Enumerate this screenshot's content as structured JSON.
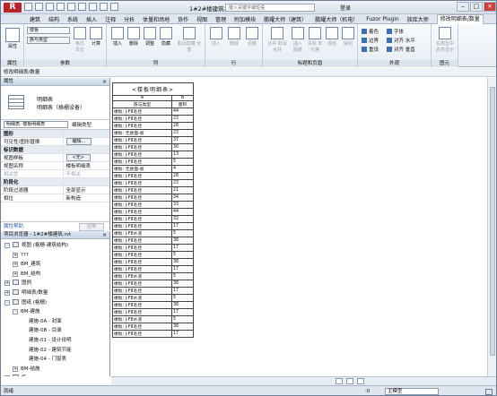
{
  "window": {
    "title": "1#2#楼建筑.rvt -",
    "search_placeholder": "键入关键字或短语",
    "login": "登录"
  },
  "tabs": [
    "建筑",
    "结构",
    "系统",
    "插入",
    "注释",
    "分析",
    "体量和场地",
    "协作",
    "视图",
    "管理",
    "附加模块",
    "鹏耀大师（建筑）",
    "鹏耀大师（机电）",
    "Fuzor Plugin",
    "族库大师",
    "修改明细表/数量"
  ],
  "ribbon": {
    "properties": {
      "label": "属性",
      "group": "属性"
    },
    "params": {
      "combo1": "楼板",
      "combo2": "族与类型",
      "format_unit": "格式\n单位",
      "calculate": "计算",
      "group": "参数"
    },
    "cols": {
      "insert": "插入",
      "delete": "删除",
      "resize": "调整",
      "hide": "隐藏",
      "unhide_all": "取消隐藏\n全部",
      "group": "列"
    },
    "rows": {
      "insert": "插入",
      "delete": "删除",
      "resize": "调整",
      "group": "行"
    },
    "titles": {
      "merge": "合并\n取消合并",
      "insert_image": "插入\n图像",
      "clear_cell": "清除\n单元格",
      "group_btn": "成组",
      "ungroup": "解组",
      "group": "标题和页眉"
    },
    "appearance": {
      "shading": "着色",
      "borders": "边界",
      "reset": "重设",
      "font": "字体",
      "align_h": "对齐\n水平",
      "align_v": "对齐\n垂直",
      "group": "外观"
    },
    "element": {
      "highlight": "在模型中\n高亮显示",
      "group": "图元"
    }
  },
  "modify_bar": "修改明细表/数量",
  "properties": {
    "header": "属性",
    "type_name": "明细表",
    "type_sub": "明细表（格栅设备）",
    "selector": "明细表: 楼板明细表",
    "edit_type": "编辑类型",
    "rows": [
      {
        "section": true,
        "name": "图形",
        "value": ""
      },
      {
        "name": "可见性/图形替换",
        "value": "编辑...",
        "button": true
      },
      {
        "section": true,
        "name": "标识数据",
        "value": ""
      },
      {
        "name": "视图样板",
        "value": "<无>",
        "button": true
      },
      {
        "name": "视图名称",
        "value": "楼板明细表"
      },
      {
        "name": "相关性",
        "value": "不相关",
        "grey": true
      },
      {
        "section": true,
        "name": "阶段化",
        "value": ""
      },
      {
        "name": "阶段过滤器",
        "value": "全部显示"
      },
      {
        "name": "相位",
        "value": "新构造"
      }
    ],
    "help": "属性帮助",
    "apply": "应用"
  },
  "browser": {
    "header": "项目浏览器 - 1#2#楼建筑.rvt",
    "items": [
      {
        "label": "视图 (格栅-建筑结构)",
        "indent": 0,
        "toggle": "-",
        "icon": true
      },
      {
        "label": "???",
        "indent": 1,
        "toggle": "+"
      },
      {
        "label": "BM_建筑",
        "indent": 1,
        "toggle": "+"
      },
      {
        "label": "BM_结构",
        "indent": 1,
        "toggle": "+"
      },
      {
        "label": "图例",
        "indent": 0,
        "toggle": "+",
        "icon": true
      },
      {
        "label": "明细表/数量",
        "indent": 0,
        "toggle": "+",
        "icon": true
      },
      {
        "label": "图纸 (格栅)",
        "indent": 0,
        "toggle": "-",
        "icon": true
      },
      {
        "label": "BM-建施",
        "indent": 1,
        "toggle": "-"
      },
      {
        "label": "建施-0A - 封面",
        "indent": 3
      },
      {
        "label": "建施-0B - 目录",
        "indent": 3
      },
      {
        "label": "建施-01 - 设计说明",
        "indent": 3
      },
      {
        "label": "建施-02 - 建筑节能",
        "indent": 3
      },
      {
        "label": "建施-04 - 门窗表",
        "indent": 3
      },
      {
        "label": "BM-结施",
        "indent": 1,
        "toggle": "+"
      },
      {
        "label": "族",
        "indent": 0,
        "toggle": "+",
        "icon": true
      }
    ]
  },
  "schedule": {
    "title": "<楼板明细表>",
    "col_letters": [
      "A",
      "B"
    ],
    "col_headers": [
      "族与类型",
      "面积"
    ],
    "rows": [
      [
        "楼板: J-F8毛坯",
        "44"
      ],
      [
        "楼板: J-F8毛坯",
        "23"
      ],
      [
        "楼板: J-F8毛坯",
        "28"
      ],
      [
        "楼板: 无屋面-板",
        "23"
      ],
      [
        "楼板: J-F8毛坯",
        "37"
      ],
      [
        "楼板: J-F8毛坯",
        "30"
      ],
      [
        "楼板: J-F8毛坯",
        "13"
      ],
      [
        "楼板: J-F8毛坯",
        "5"
      ],
      [
        "楼板: 无屋面-板",
        "4"
      ],
      [
        "楼板: J-F8毛坯",
        "28"
      ],
      [
        "楼板: J-F8毛坯",
        "23"
      ],
      [
        "楼板: J-F8毛坯",
        "21"
      ],
      [
        "楼板: J-F8毛坯",
        "34"
      ],
      [
        "楼板: J-F8毛坯",
        "33"
      ],
      [
        "楼板: J-F8毛坯",
        "44"
      ],
      [
        "楼板: J-F8毛坯",
        "32"
      ],
      [
        "楼板: J-F8毛坯",
        "17"
      ],
      [
        "楼板: J-F8水泥",
        "5"
      ],
      [
        "楼板: J-F8毛坯",
        "38"
      ],
      [
        "楼板: J-F8毛坯",
        "17"
      ],
      [
        "楼板: J-F8毛坯",
        "5"
      ],
      [
        "楼板: J-F8毛坯",
        "38"
      ],
      [
        "楼板: J-F8毛坯",
        "17"
      ],
      [
        "楼板: J-F8水泥",
        "5"
      ],
      [
        "楼板: J-F8毛坯",
        "38"
      ],
      [
        "楼板: J-F8毛坯",
        "17"
      ],
      [
        "楼板: J-F8水泥",
        "5"
      ],
      [
        "楼板: J-F8毛坯",
        "38"
      ],
      [
        "楼板: J-F8毛坯",
        "17"
      ],
      [
        "楼板: J-F8水泥",
        "5"
      ],
      [
        "楼板: J-F8毛坯",
        "38"
      ],
      [
        "楼板: J-F8毛坯",
        "17"
      ]
    ]
  },
  "status": {
    "ready": "就绪",
    "zero": ":0",
    "model": "主模型"
  }
}
